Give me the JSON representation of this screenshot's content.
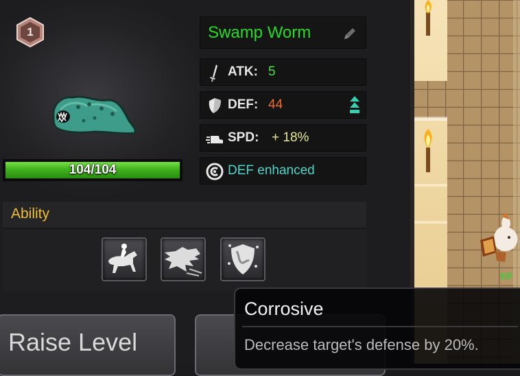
{
  "monster": {
    "level": "1",
    "name": "Swamp Worm",
    "hp": {
      "text": "104/104",
      "fraction": 1.0
    },
    "stats": {
      "atk_label": "ATK:",
      "atk_value": "5",
      "def_label": "DEF:",
      "def_value": "44",
      "spd_label": "SPD:",
      "spd_value": "+ 18%"
    },
    "status": "DEF enhanced"
  },
  "ability": {
    "title": "Ability",
    "slots": [
      {
        "icon": "horse-rider-icon"
      },
      {
        "icon": "wolf-dash-icon"
      },
      {
        "icon": "acid-shield-icon"
      }
    ]
  },
  "buttons": {
    "raise_level": "Raise Level"
  },
  "tooltip": {
    "title": "Corrosive",
    "description": "Decrease target's defense by 20%."
  },
  "dungeon": {
    "unit_label": "Elf"
  },
  "colors": {
    "name": "#22dd22",
    "atk_value": "#4ce04c",
    "def_value": "#f06d1f",
    "spd_value": "#e8e89a",
    "status": "#4ad7c7",
    "ability_title": "#f0c033",
    "hp_fill": "#3fb21d"
  }
}
